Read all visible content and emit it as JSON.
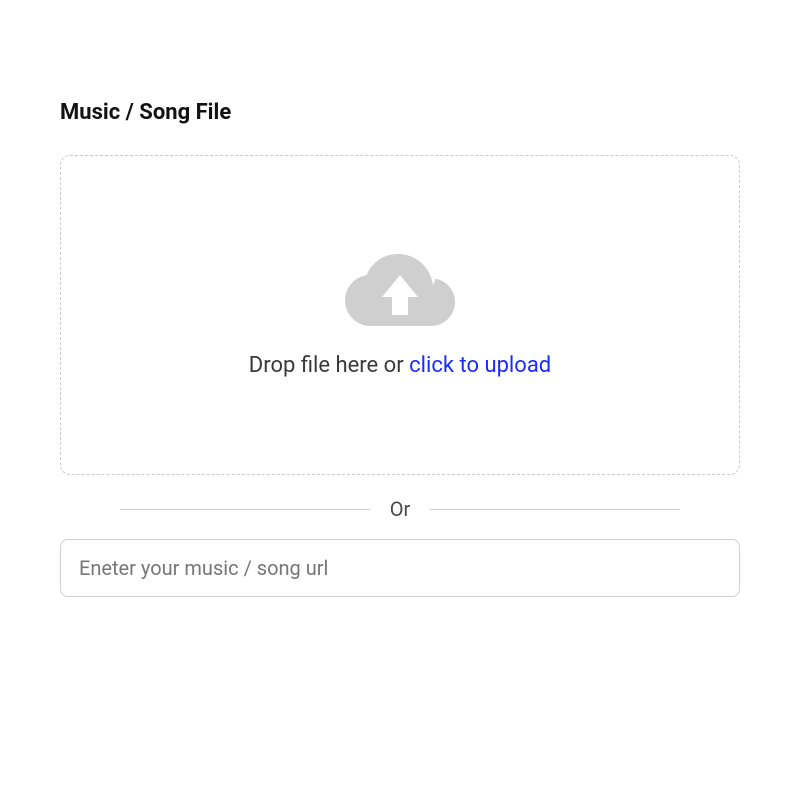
{
  "section": {
    "title": "Music / Song File"
  },
  "dropzone": {
    "prompt_prefix": "Drop file here or ",
    "prompt_link": "click to upload",
    "icon_name": "cloud-upload-icon"
  },
  "divider": {
    "label": "Or"
  },
  "url_input": {
    "placeholder": "Eneter your music / song url",
    "value": ""
  },
  "colors": {
    "link": "#1a2cff",
    "border": "#c9c9c9",
    "icon_fill": "#cfcfcf"
  }
}
